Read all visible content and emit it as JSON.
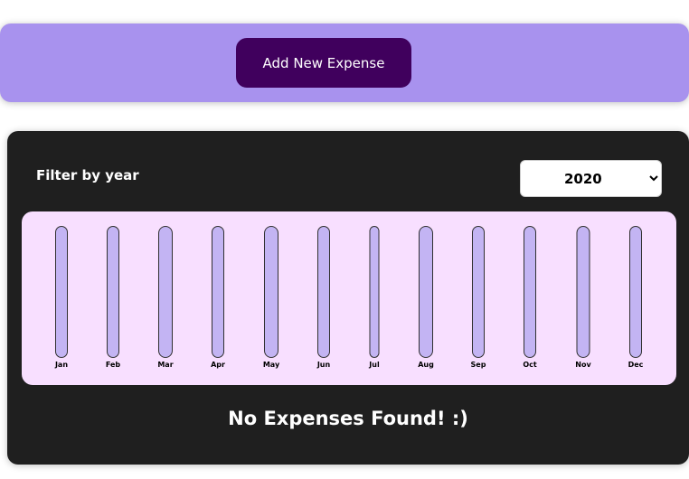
{
  "new_expense": {
    "add_button_label": "Add New Expense"
  },
  "filter": {
    "label": "Filter by year",
    "selected_year": "2020",
    "options": [
      "2020"
    ]
  },
  "colors": {
    "header_bg": "#a892ee",
    "button_bg": "#40005d",
    "panel_bg": "#1f1f1f",
    "chart_bg": "#f8dfff",
    "bar_bg": "#c3b4f3"
  },
  "chart_data": {
    "type": "bar",
    "categories": [
      "Jan",
      "Feb",
      "Mar",
      "Apr",
      "May",
      "Jun",
      "Jul",
      "Aug",
      "Sep",
      "Oct",
      "Nov",
      "Dec"
    ],
    "values": [
      0,
      0,
      0,
      0,
      0,
      0,
      0,
      0,
      0,
      0,
      0,
      0
    ]
  },
  "message": {
    "empty_text": "No Expenses Found! :)"
  }
}
